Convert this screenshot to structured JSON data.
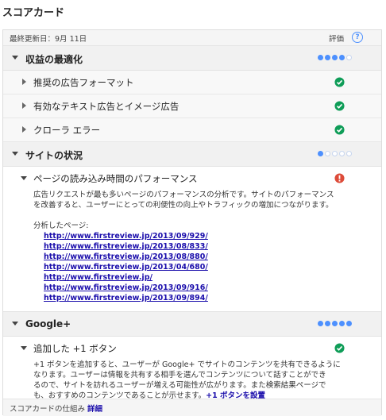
{
  "page": {
    "title": "スコアカード"
  },
  "header": {
    "updated": "最終更新日：9月 11日",
    "rating_label": "評価",
    "help_glyph": "?"
  },
  "sections": [
    {
      "title": "収益の最適化",
      "rating": {
        "filled": 4,
        "total": 5
      },
      "items": [
        {
          "label": "推奨の広告フォーマット",
          "status": "ok"
        },
        {
          "label": "有効なテキスト広告とイメージ広告",
          "status": "ok"
        },
        {
          "label": "クローラ エラー",
          "status": "ok"
        }
      ]
    },
    {
      "title": "サイトの状況",
      "rating": {
        "filled": 1,
        "total": 5
      },
      "item": {
        "label": "ページの読み込み時間のパフォーマンス",
        "status": "warning",
        "description_1": "広告リクエストが最も多いページのパフォーマンスの分析です。サイトのパフォーマンス",
        "description_2": "を改善すると、ユーザーにとっての利便性の向上やトラフィックの増加につながります。",
        "analyzed_label": "分析したページ:",
        "urls": [
          "http://www.firstreview.jp/2013/09/929/",
          "http://www.firstreview.jp/2013/08/833/",
          "http://www.firstreview.jp/2013/08/880/",
          "http://www.firstreview.jp/2013/04/680/",
          "http://www.firstreview.jp/",
          "http://www.firstreview.jp/2013/09/916/",
          "http://www.firstreview.jp/2013/09/894/"
        ]
      }
    },
    {
      "title": "Google+",
      "rating": {
        "filled": 5,
        "total": 5
      },
      "item": {
        "label": "追加した +1 ボタン",
        "status": "ok",
        "description_1": "+1 ボタンを追加すると、ユーザーが Google+ でサイトのコンテンツを共有できるように",
        "description_2": "なります。ユーザーは情報を共有する相手を選んでコンテンツについて話すことができ",
        "description_3": "るので、サイトを訪れるユーザーが増える可能性が広がります。また検索結果ページで",
        "description_4": "も、おすすめのコンテンツであることが示せます。",
        "link": "+1 ボタンを設置"
      }
    }
  ],
  "footer": {
    "text": "スコアカードの仕組み",
    "link": "詳細"
  },
  "colors": {
    "accent": "#4d90fe",
    "ok": "#0f9d58",
    "warning": "#dd4b39",
    "link": "#1a0dab"
  },
  "icons": {
    "ok": "check-circle-icon",
    "warning": "exclamation-circle-icon",
    "help": "help-icon"
  }
}
